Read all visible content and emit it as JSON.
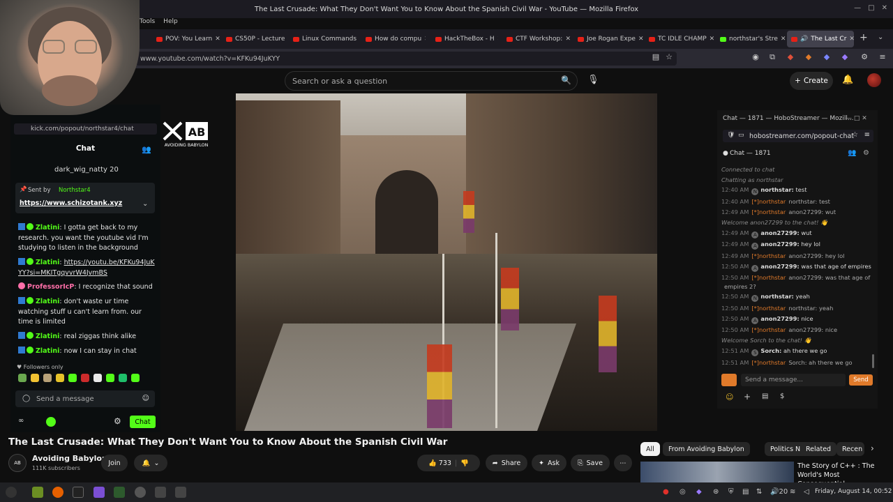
{
  "window": {
    "title": "The Last Crusade: What They Don't Want You to Know About the Spanish Civil War - YouTube — Mozilla Firefox"
  },
  "menubar": [
    "Tools",
    "Help"
  ],
  "tabs": [
    {
      "label": "POV: You Learn"
    },
    {
      "label": "CS50P - Lecture"
    },
    {
      "label": "Linux Commands"
    },
    {
      "label": "How do compu"
    },
    {
      "label": "HackTheBox - H"
    },
    {
      "label": "CTF Workshop:"
    },
    {
      "label": "Joe Rogan Expe"
    },
    {
      "label": "TC IDLE CHAMP"
    },
    {
      "label": "northstar's Stre"
    },
    {
      "label": "The Last Cr"
    }
  ],
  "url": "www.youtube.com/watch?v=KFKu94JuKYY",
  "yt_header": {
    "search_placeholder": "Search or ask a question",
    "create_label": "Create"
  },
  "kick": {
    "url": "kick.com/popout/northstar4/chat",
    "chat_header": "Chat",
    "subscriber_line": "dark_wig_natty 20",
    "pinned": {
      "sent_by": "Sent by",
      "sender": "Northstar4",
      "link": "https://www.schizotank.xyz"
    },
    "messages": [
      {
        "user": "Zlatini",
        "text": "I gotta get back to my research. you want the youtube vid I'm studying to listen in the background"
      },
      {
        "user": "Zlatini",
        "text": "https://youtu.be/KFKu94JuKYY?si=MKITgqvvrW4JvmBS"
      },
      {
        "user": "ProfessorIcP",
        "text": "I recognize that sound"
      },
      {
        "user": "Zlatini",
        "text": "don't waste ur time watching stuff u can't learn from. our time is limited"
      },
      {
        "user": "Zlatini",
        "text": "real ziggas think alike"
      },
      {
        "user": "Zlatini",
        "text": "now I can stay in chat"
      }
    ],
    "followers_only": "Followers only",
    "input_placeholder": "Send a message",
    "chat_button": "Chat"
  },
  "logo": {
    "text": "AB",
    "subtitle": "AVOIDING BABYLON"
  },
  "hobo": {
    "window_title": "Chat — 1871 — HoboStreamer — Mozill...",
    "url": "hobostreamer.com/popout-chat",
    "header": "Chat — 1871",
    "lines": [
      {
        "kind": "sys",
        "text": "Connected to chat"
      },
      {
        "kind": "sys",
        "text": "Chatting as northstar"
      },
      {
        "kind": "msg",
        "time": "12:40 AM",
        "av": "N",
        "name": "northstar:",
        "text": "test"
      },
      {
        "kind": "relay",
        "time": "12:40 AM",
        "tag": "northstar",
        "text": "northstar: test"
      },
      {
        "kind": "relay",
        "time": "12:49 AM",
        "tag": "northstar",
        "text": "anon27299: wut"
      },
      {
        "kind": "sys",
        "text": "Welcome anon27299 to the chat! 👋"
      },
      {
        "kind": "msg",
        "time": "12:49 AM",
        "av": "A",
        "name": "anon27299:",
        "text": "wut"
      },
      {
        "kind": "msg",
        "time": "12:49 AM",
        "av": "A",
        "name": "anon27299:",
        "text": "hey lol"
      },
      {
        "kind": "relay",
        "time": "12:49 AM",
        "tag": "northstar",
        "text": "anon27299: hey lol"
      },
      {
        "kind": "msg",
        "time": "12:50 AM",
        "av": "A",
        "name": "anon27299:",
        "text": "was that age of empires 2?"
      },
      {
        "kind": "relay",
        "time": "12:50 AM",
        "tag": "northstar",
        "text": "anon27299: was that age of"
      },
      {
        "kind": "cont",
        "text": "empires 2?"
      },
      {
        "kind": "msg",
        "time": "12:50 AM",
        "av": "N",
        "name": "northstar:",
        "text": "yeah"
      },
      {
        "kind": "relay",
        "time": "12:50 AM",
        "tag": "northstar",
        "text": "northstar: yeah"
      },
      {
        "kind": "msg",
        "time": "12:50 AM",
        "av": "A",
        "name": "anon27299:",
        "text": "nice"
      },
      {
        "kind": "relay",
        "time": "12:50 AM",
        "tag": "northstar",
        "text": "anon27299: nice"
      },
      {
        "kind": "sys",
        "text": "Welcome Sorch to the chat! 👋"
      },
      {
        "kind": "msg",
        "time": "12:51 AM",
        "av": "S",
        "name": "Sorch:",
        "text": "ah there we go"
      },
      {
        "kind": "relay",
        "time": "12:51 AM",
        "tag": "northstar",
        "text": "Sorch: ah there we go"
      }
    ],
    "input_placeholder": "Send a message...",
    "send_label": "Send"
  },
  "video": {
    "title": "The Last Crusade: What They Don't Want You to Know About the Spanish Civil War",
    "channel": "Avoiding Babylon",
    "channel_avatar": "AB",
    "subscribers": "111K subscribers",
    "join_label": "Join",
    "likes": "733",
    "share_label": "Share",
    "ask_label": "Ask",
    "save_label": "Save"
  },
  "chips": [
    "All",
    "From Avoiding Babylon",
    "Politics News",
    "Related",
    "Recen"
  ],
  "recommendation": {
    "title": "The Story of C++ : The World's Most Consequential"
  },
  "taskbar": {
    "clock": "Friday, August 14, 00:52",
    "volume_label": "20"
  }
}
